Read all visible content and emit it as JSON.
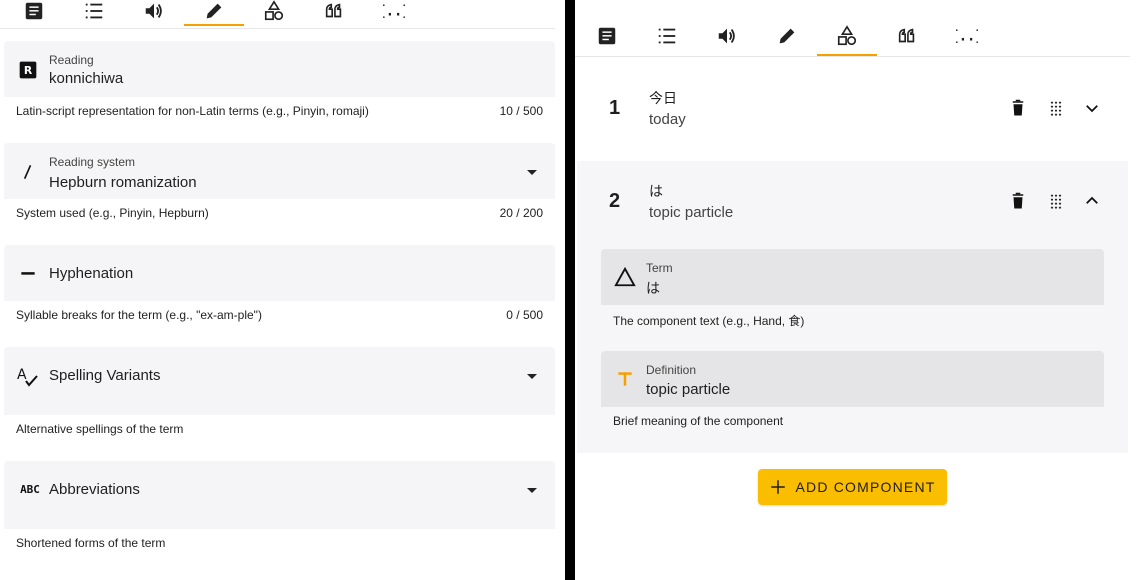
{
  "left": {
    "fields": {
      "reading": {
        "icon": "reading-r-icon",
        "label": "Reading",
        "value": "konnichiwa",
        "hint": "Latin-script representation for non-Latin terms (e.g., Pinyin, romaji)",
        "count": "10 / 500"
      },
      "reading_system": {
        "icon": "slash-icon",
        "label": "Reading system",
        "value": "Hepburn romanization",
        "hint": "System used (e.g., Pinyin, Hepburn)",
        "count": "20 / 200"
      },
      "hyphenation": {
        "icon": "minus-icon",
        "placeholder": "Hyphenation",
        "hint": "Syllable breaks for the term (e.g., \"ex-am-ple\")",
        "count": "0 / 500"
      },
      "spelling_variants": {
        "icon": "spellcheck-icon",
        "title": "Spelling Variants",
        "hint": "Alternative spellings of the term"
      },
      "abbreviations": {
        "icon": "abc-icon",
        "icon_text": "ABC",
        "title": "Abbreviations",
        "hint": "Shortened forms of the term"
      }
    }
  },
  "right": {
    "items": [
      {
        "number": "1",
        "term": "今日",
        "definition": "today"
      },
      {
        "number": "2",
        "term": "は",
        "definition": "topic particle",
        "components": {
          "term": {
            "icon": "triangle-icon",
            "label": "Term",
            "value": "は",
            "hint": "The component text (e.g., Hand, 食)"
          },
          "definition": {
            "icon": "text-t-icon",
            "label": "Definition",
            "value": "topic particle",
            "hint": "Brief meaning of the component"
          }
        }
      }
    ],
    "add_button": {
      "label": "ADD COMPONENT"
    }
  },
  "tabs": [
    "article-icon",
    "list-numbered-icon",
    "volume-icon",
    "pencil-icon",
    "shapes-icon",
    "quote-icon",
    "braces-icon"
  ],
  "colors": {
    "accent": "#f4a100",
    "button": "#fbbd00",
    "field_bg": "#f5f4f7",
    "divider": "#000000"
  }
}
